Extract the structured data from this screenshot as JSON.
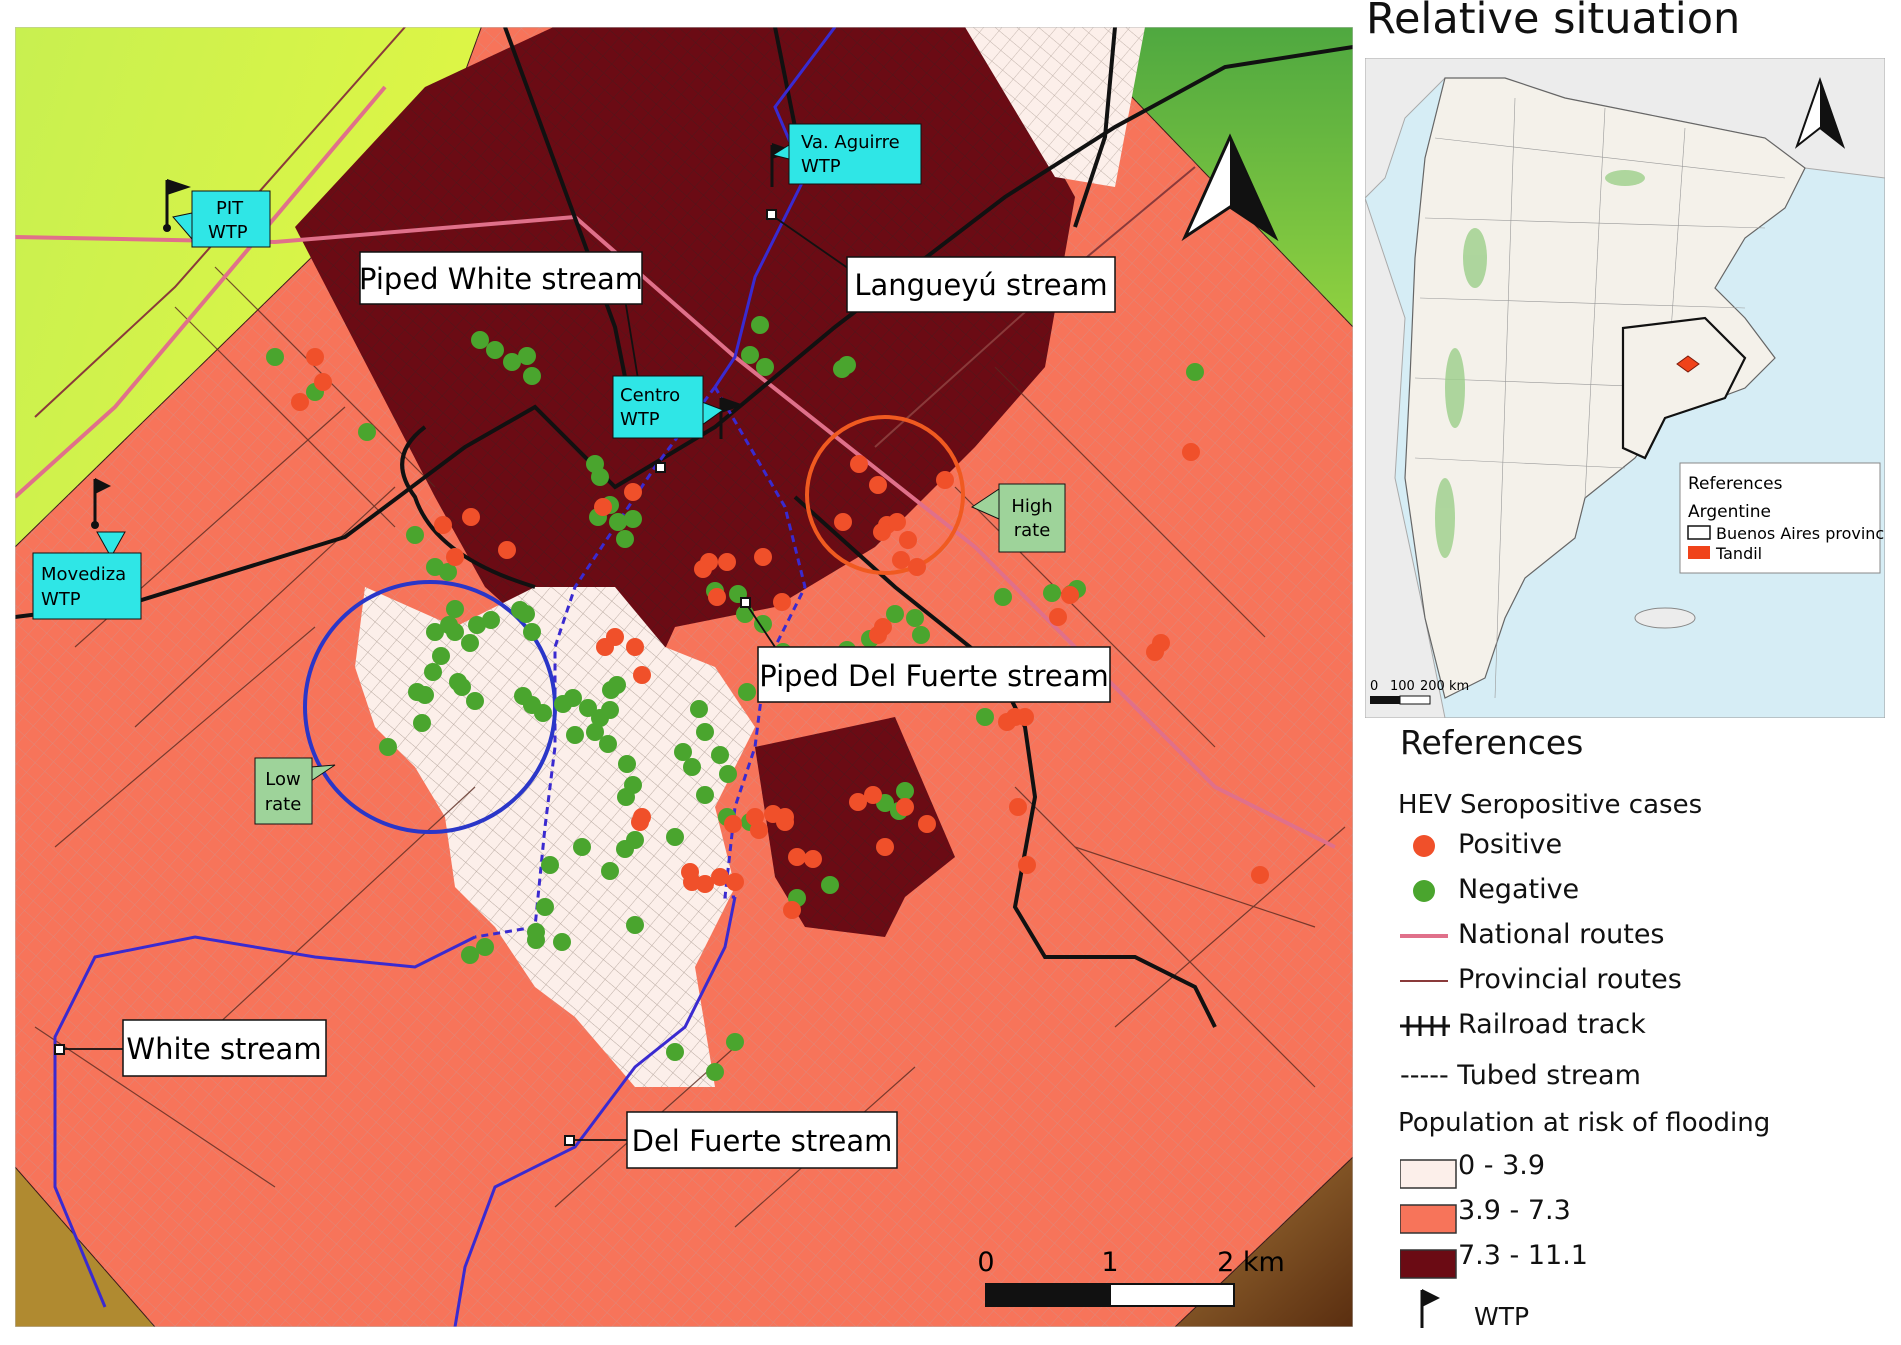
{
  "inset": {
    "title": "Relative situation",
    "legend_title": "References",
    "country": "Argentine",
    "province_label": "Buenos Aires province",
    "city_label": "Tandil",
    "scale": [
      "0",
      "100",
      "200 km"
    ]
  },
  "map_labels": {
    "piped_white": "Piped White stream",
    "langueyu": "Langueyú stream",
    "piped_del_fuerte": "Piped Del Fuerte stream",
    "white_stream": "White stream",
    "del_fuerte_stream": "Del Fuerte stream",
    "high_rate": [
      "High",
      "rate"
    ],
    "low_rate": [
      "Low",
      "rate"
    ],
    "wtp_pit": [
      "PIT",
      "WTP"
    ],
    "wtp_aguirre": [
      "Va. Aguirre",
      "WTP"
    ],
    "wtp_centro": [
      "Centro",
      "WTP"
    ],
    "wtp_movediza": [
      "Movediza",
      "WTP"
    ],
    "scale": [
      "0",
      "1",
      "2 km"
    ]
  },
  "legend": {
    "title": "References",
    "hev_title": "HEV Seropositive cases",
    "positive": "Positive",
    "negative": "Negative",
    "national_routes": "National routes",
    "provincial_routes": "Provincial routes",
    "railroad": "Railroad track",
    "tubed": "----- Tubed stream",
    "flood_title": "Population at risk of flooding",
    "class_low": "0 - 3.9",
    "class_mid": "3.9 - 7.3",
    "class_high": "7.3 - 11.1",
    "wtp": "WTP"
  },
  "colors": {
    "positive": "#f0502a",
    "negative": "#4aa52e",
    "class_low": "#fcefea",
    "class_mid": "#f7745a",
    "class_high": "#6b0b14",
    "national_route": "#e0708a",
    "provincial_route": "#8a3a3a",
    "stream": "#3a2ad0",
    "label_cyan": "#2fe6e6",
    "label_green": "#9ed39a"
  }
}
